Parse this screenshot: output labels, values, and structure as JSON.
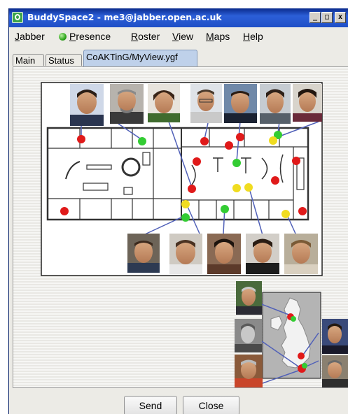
{
  "window": {
    "title": "BuddySpace2 - me3@jabber.open.ac.uk",
    "controls": {
      "minimize": "_",
      "maximize": "□",
      "close": "x"
    }
  },
  "menubar": {
    "items": [
      {
        "label_u": "J",
        "label_rest": "abber"
      },
      {
        "label_u": "P",
        "label_rest": "resence",
        "icon": "presence-green-dot"
      },
      {
        "label_u": "R",
        "label_rest": "oster"
      },
      {
        "label_u": "V",
        "label_rest": "iew"
      },
      {
        "label_u": "M",
        "label_rest": "aps"
      },
      {
        "label_u": "H",
        "label_rest": "elp"
      }
    ]
  },
  "tabs": [
    {
      "label": "Main",
      "active": false
    },
    {
      "label": "Status",
      "active": false
    },
    {
      "label": "CoAKTinG/MyView.ygf",
      "active": true
    }
  ],
  "map_view": {
    "status_colors": {
      "online": "#e01a1a",
      "available": "#33cc33",
      "away": "#f0dc20"
    },
    "floorplan_markers": [
      "red",
      "red",
      "green",
      "red",
      "red",
      "red",
      "green",
      "red",
      "red",
      "green",
      "yellow",
      "yellow",
      "red",
      "red",
      "yellow",
      "green",
      "red",
      "green",
      "yellow",
      "red"
    ],
    "uk_map_markers": [
      "red",
      "green",
      "red",
      "red",
      "green"
    ]
  },
  "buttons": {
    "send": "Send",
    "close": "Close"
  }
}
